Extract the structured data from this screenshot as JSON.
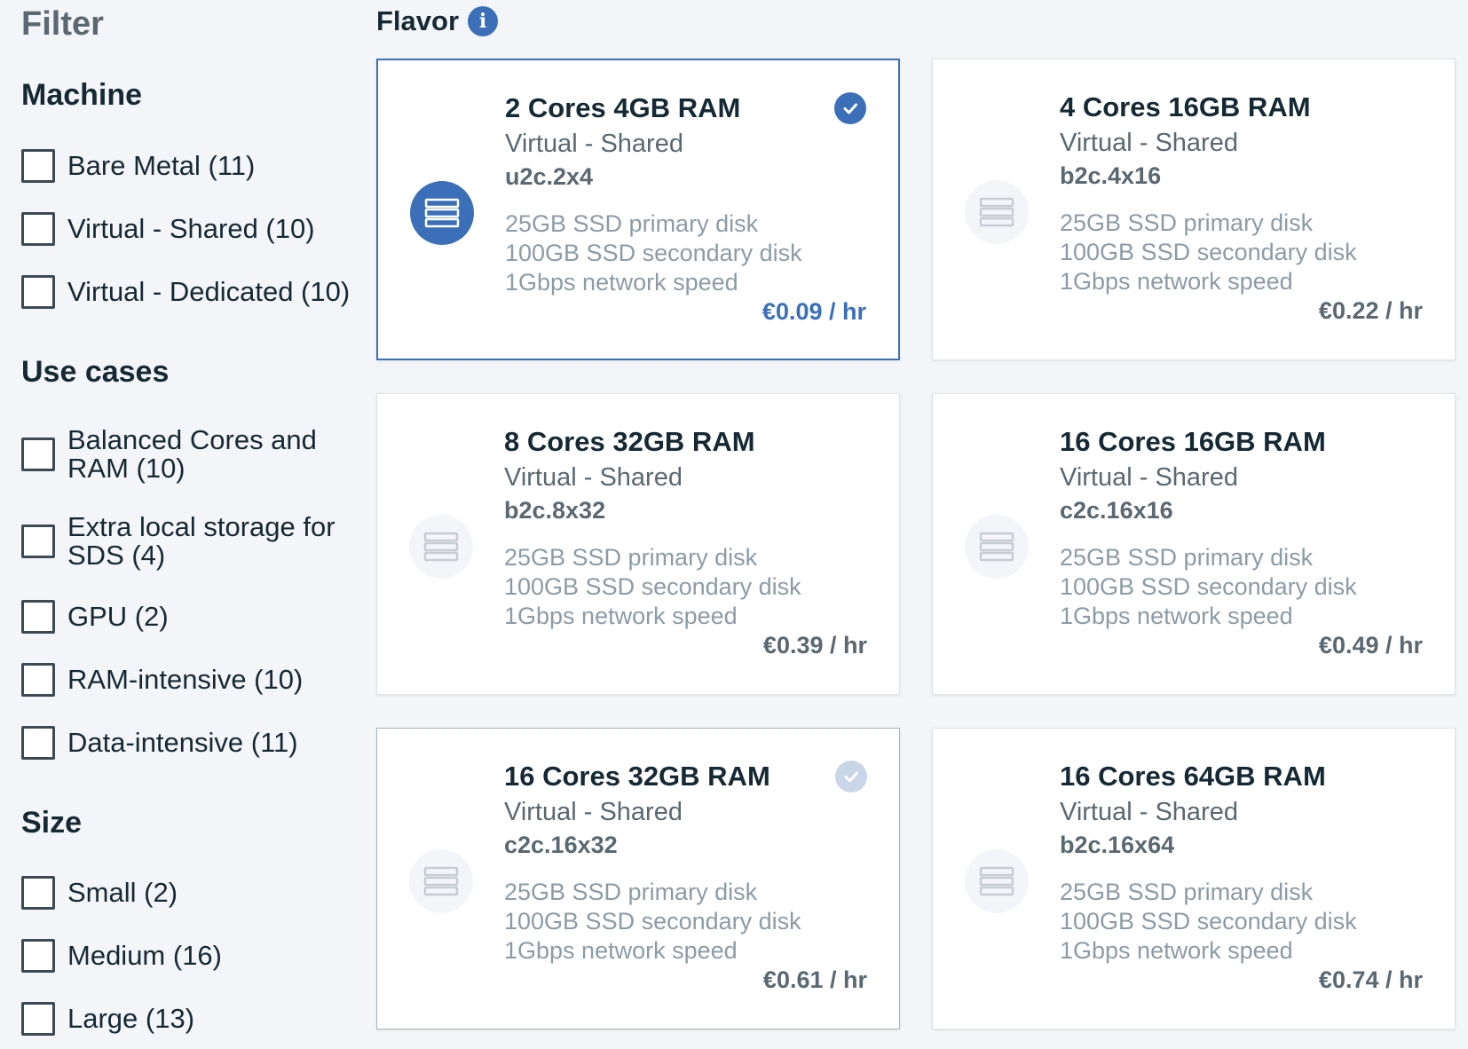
{
  "sidebar": {
    "title": "Filter",
    "groups": [
      {
        "title": "Machine",
        "options": [
          {
            "label": "Bare Metal (11)"
          },
          {
            "label": "Virtual - Shared (10)"
          },
          {
            "label": "Virtual - Dedicated (10)"
          }
        ]
      },
      {
        "title": "Use cases",
        "options": [
          {
            "label": "Balanced Cores and RAM (10)"
          },
          {
            "label": "Extra local storage for SDS (4)"
          },
          {
            "label": "GPU (2)"
          },
          {
            "label": "RAM-intensive (10)"
          },
          {
            "label": "Data-intensive (11)"
          }
        ]
      },
      {
        "title": "Size",
        "options": [
          {
            "label": "Small (2)"
          },
          {
            "label": "Medium (16)"
          },
          {
            "label": "Large (13)"
          }
        ]
      }
    ]
  },
  "flavor": {
    "title": "Flavor",
    "info_icon": "info-icon",
    "cards": [
      {
        "name": "2 Cores 4GB RAM",
        "type": "Virtual - Shared",
        "code": "u2c.2x4",
        "spec1": "25GB SSD primary disk",
        "spec2": "100GB SSD secondary disk",
        "spec3": "1Gbps network speed",
        "price": "€0.09 / hr",
        "selected": true
      },
      {
        "name": "4 Cores 16GB RAM",
        "type": "Virtual - Shared",
        "code": "b2c.4x16",
        "spec1": "25GB SSD primary disk",
        "spec2": "100GB SSD secondary disk",
        "spec3": "1Gbps network speed",
        "price": "€0.22 / hr",
        "selected": false
      },
      {
        "name": "8 Cores 32GB RAM",
        "type": "Virtual - Shared",
        "code": "b2c.8x32",
        "spec1": "25GB SSD primary disk",
        "spec2": "100GB SSD secondary disk",
        "spec3": "1Gbps network speed",
        "price": "€0.39 / hr",
        "selected": false
      },
      {
        "name": "16 Cores 16GB RAM",
        "type": "Virtual - Shared",
        "code": "c2c.16x16",
        "spec1": "25GB SSD primary disk",
        "spec2": "100GB SSD secondary disk",
        "spec3": "1Gbps network speed",
        "price": "€0.49 / hr",
        "selected": false
      },
      {
        "name": "16 Cores 32GB RAM",
        "type": "Virtual - Shared",
        "code": "c2c.16x32",
        "spec1": "25GB SSD primary disk",
        "spec2": "100GB SSD secondary disk",
        "spec3": "1Gbps network speed",
        "price": "€0.61 / hr",
        "selected": false,
        "hover_check": true
      },
      {
        "name": "16 Cores 64GB RAM",
        "type": "Virtual - Shared",
        "code": "b2c.16x64",
        "spec1": "25GB SSD primary disk",
        "spec2": "100GB SSD secondary disk",
        "spec3": "1Gbps network speed",
        "price": "€0.74 / hr",
        "selected": false
      }
    ]
  },
  "colors": {
    "accent": "#3b70b8",
    "text_primary": "#152935",
    "text_secondary": "#5a6872",
    "text_muted": "#8c9ba5",
    "background": "#f3f5f8"
  }
}
